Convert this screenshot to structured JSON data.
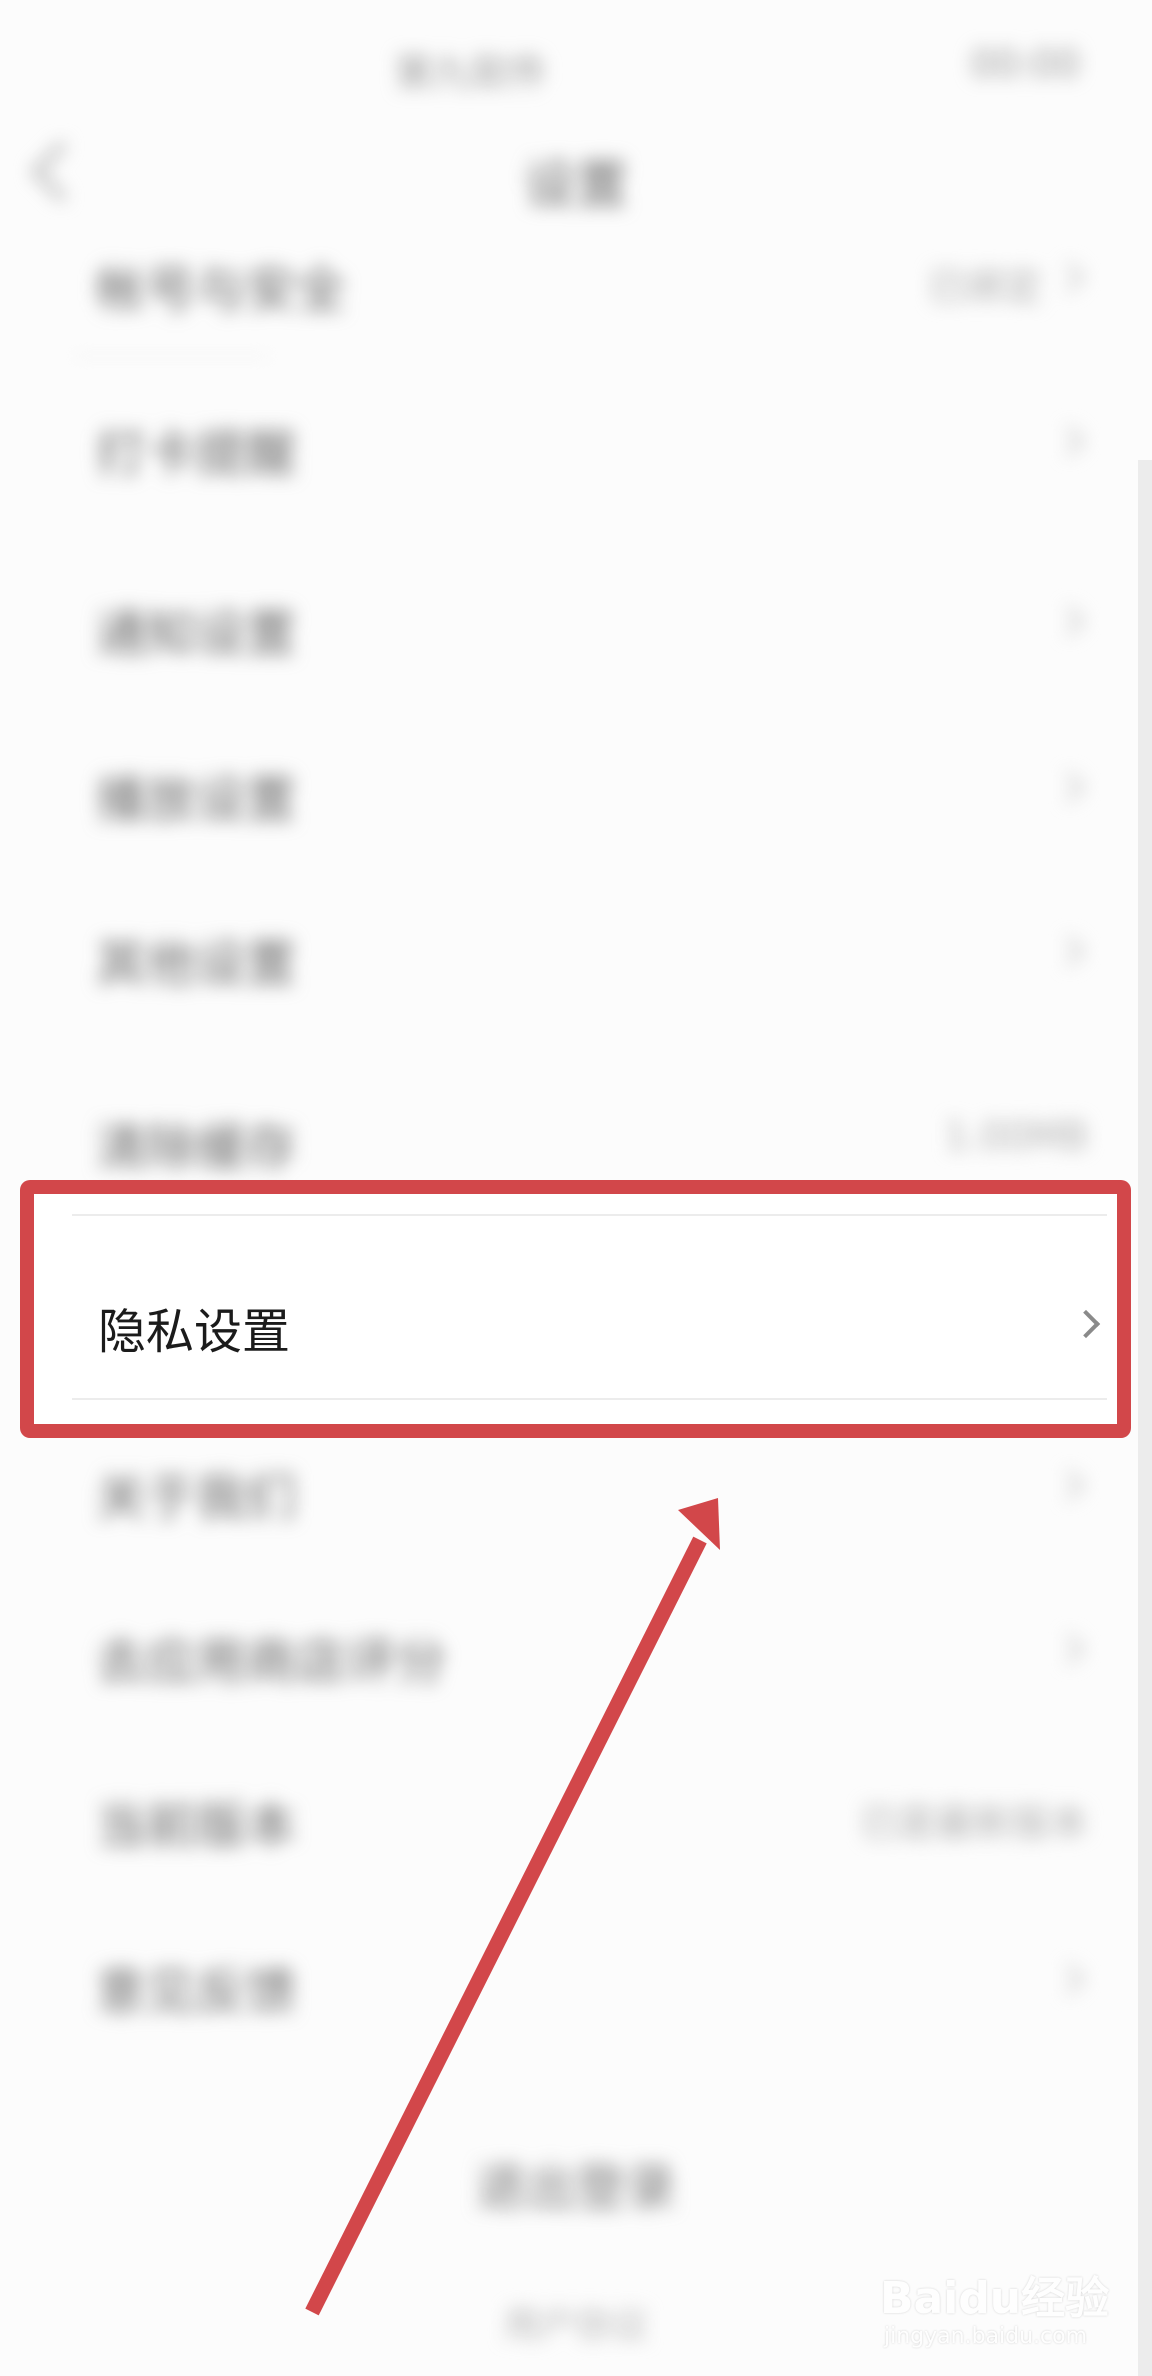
{
  "status_bar": {
    "left_text": "第九软件",
    "right_text": "00:00"
  },
  "nav": {
    "title": "设置"
  },
  "settings": [
    {
      "label": "帐号与安全",
      "value": "已绑定"
    },
    {
      "label": "打卡提醒",
      "value": ""
    },
    {
      "label": "通知设置",
      "value": ""
    },
    {
      "label": "播放设置",
      "value": ""
    },
    {
      "label": "其他设置",
      "value": ""
    },
    {
      "label": "清除缓存",
      "value": "1.00MB"
    }
  ],
  "settings_after": [
    {
      "label": "关于我们",
      "value": ""
    },
    {
      "label": "去应用商店评分",
      "value": ""
    },
    {
      "label": "当前版本",
      "value": "已是最新版本"
    },
    {
      "label": "意见反馈",
      "value": ""
    }
  ],
  "focused_item": {
    "label": "隐私设置",
    "chevron_icon": "chevron-right-icon"
  },
  "logout": {
    "label": "退出登录"
  },
  "footer": {
    "link": "用户协议"
  },
  "annotation": {
    "frame_color": "#d2474a",
    "arrow_color": "#d2474a"
  },
  "watermark": {
    "main": "Baidu经验",
    "sub": "jingyan.baidu.com"
  }
}
